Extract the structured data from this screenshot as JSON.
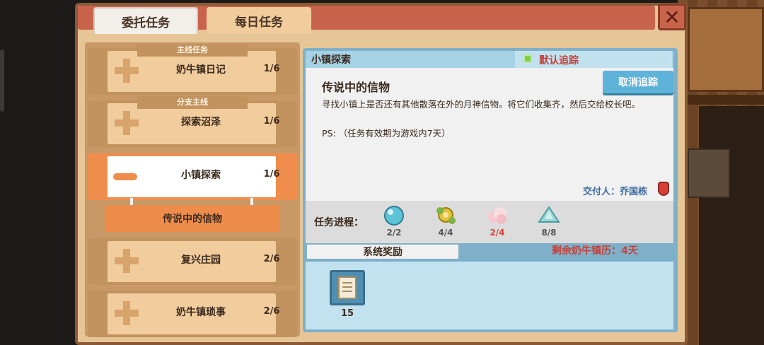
{
  "tabs": {
    "commission": "委托任务",
    "daily": "每日任务"
  },
  "close_label": "✕",
  "quests": [
    {
      "tag": "主线任务",
      "name": "奶牛镇日记",
      "count": "1/6"
    },
    {
      "tag": "分支主线",
      "name": "探索沼泽",
      "count": "1/6"
    },
    {
      "tag": "",
      "name": "小镇探索",
      "count": "1/6"
    },
    {
      "tag": "",
      "name": "复兴庄园",
      "count": "2/6"
    },
    {
      "tag": "",
      "name": "奶牛镇琐事",
      "count": "2/6"
    }
  ],
  "active_subtask": "传说中的信物",
  "detail": {
    "header": "小镇探索",
    "track_label": "默认追踪",
    "cancel_track": "取消追踪",
    "item_title": "传说中的信物",
    "description": "寻找小镇上是否还有其他散落在外的月神信物。将它们收集齐，然后交给校长吧。",
    "ps": "PS: （任务有效期为游戏内7天）",
    "giver": "交付人：乔国栋",
    "progress_label": "任务进程：",
    "progress_items": [
      {
        "icon": "blue-orb-icon",
        "count": "2/2",
        "color": "#5ec3d6"
      },
      {
        "icon": "golden-flower-icon",
        "count": "4/4",
        "color": "#e2c23a"
      },
      {
        "icon": "pink-cloud-icon",
        "count": "2/4",
        "color": "#f5c9cf"
      },
      {
        "icon": "blue-crystal-icon",
        "count": "8/8",
        "color": "#9ed6d8"
      }
    ],
    "reward_tab": "系统奖励",
    "days_left": "剩余奶牛镇历：4天",
    "reward": {
      "icon": "document-icon",
      "count": "15"
    }
  }
}
